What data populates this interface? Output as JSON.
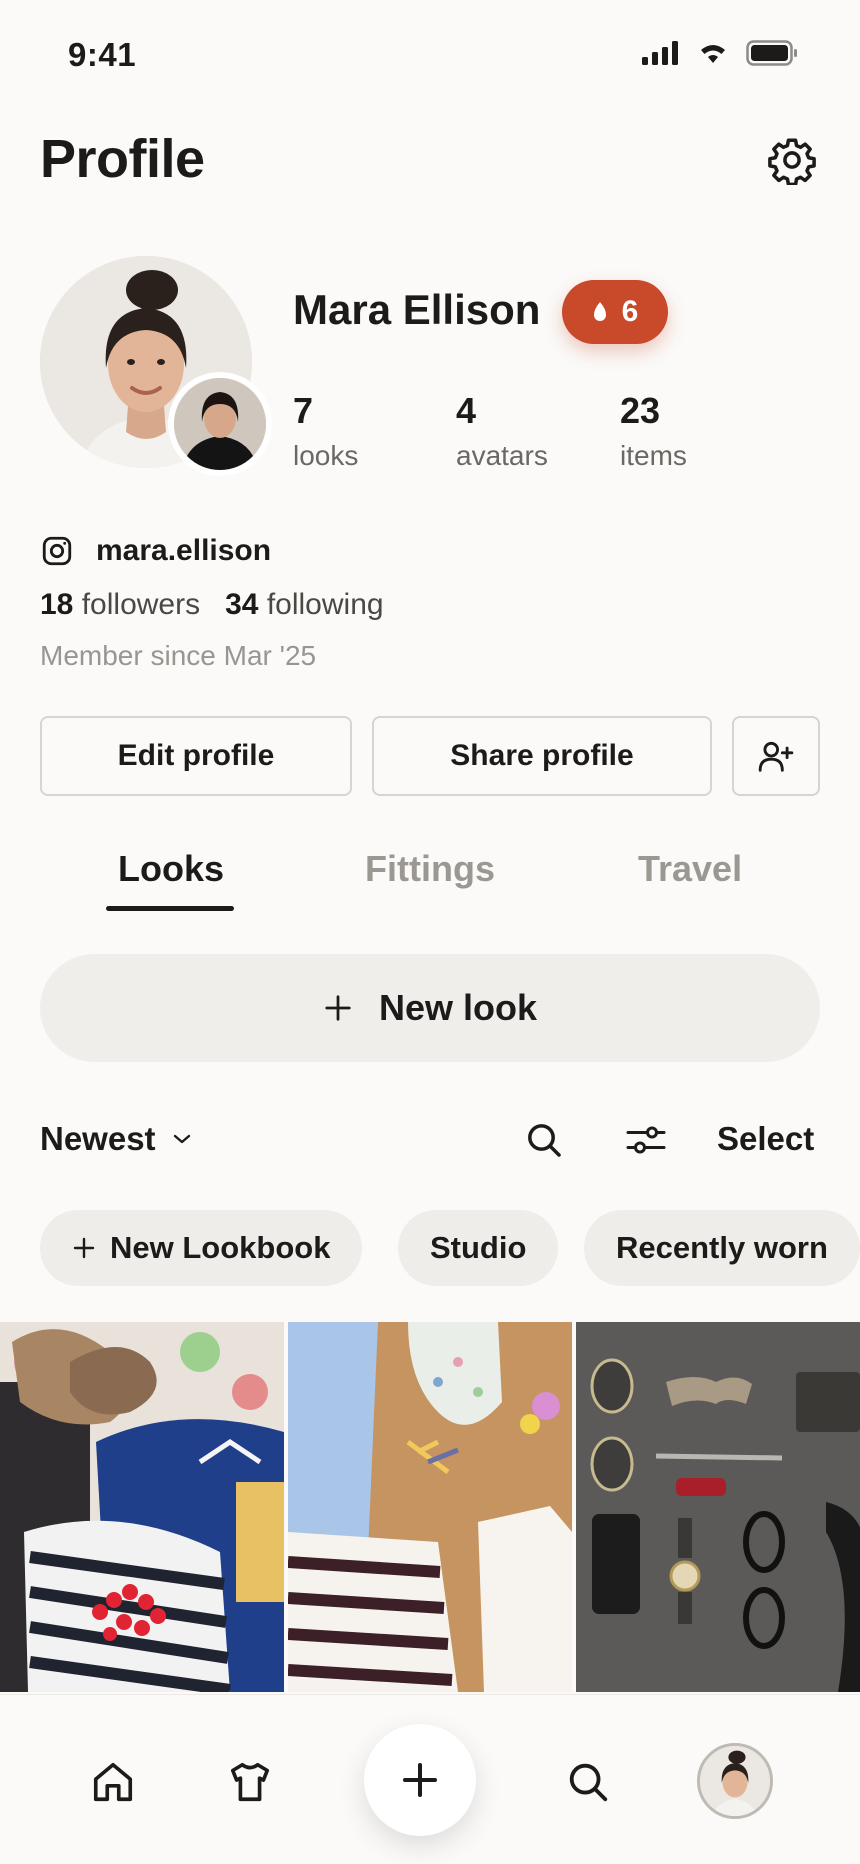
{
  "status_bar": {
    "time": "9:41"
  },
  "header": {
    "title": "Profile"
  },
  "profile": {
    "name": "Mara Ellison",
    "streak_count": "6",
    "stats": [
      {
        "value": "7",
        "label": "looks"
      },
      {
        "value": "4",
        "label": "avatars"
      },
      {
        "value": "23",
        "label": "items"
      }
    ],
    "instagram_handle": "mara.ellison",
    "followers_count": "18",
    "followers_label": "followers",
    "following_count": "34",
    "following_label": "following",
    "member_since": "Member since Mar '25"
  },
  "actions": {
    "edit_profile": "Edit profile",
    "share_profile": "Share profile"
  },
  "tabs": [
    {
      "label": "Looks",
      "active": true
    },
    {
      "label": "Fittings",
      "active": false
    },
    {
      "label": "Travel",
      "active": false
    }
  ],
  "new_look_label": "New look",
  "toolbar": {
    "sort_label": "Newest",
    "select_label": "Select"
  },
  "chips": [
    {
      "label": "New Lookbook",
      "icon": "plus-icon"
    },
    {
      "label": "Studio"
    },
    {
      "label": "Recently worn"
    }
  ],
  "icons": {
    "settings": "gear-icon",
    "streak": "flame-icon",
    "instagram": "instagram-icon",
    "add_friend": "add-person-icon",
    "nav": [
      "home-icon",
      "shirt-icon",
      "plus-icon",
      "search-icon",
      "avatar"
    ]
  },
  "colors": {
    "background": "#fbfaf8",
    "accent": "#c9492b",
    "text": "#1c1b1a",
    "muted": "#9b9792"
  }
}
